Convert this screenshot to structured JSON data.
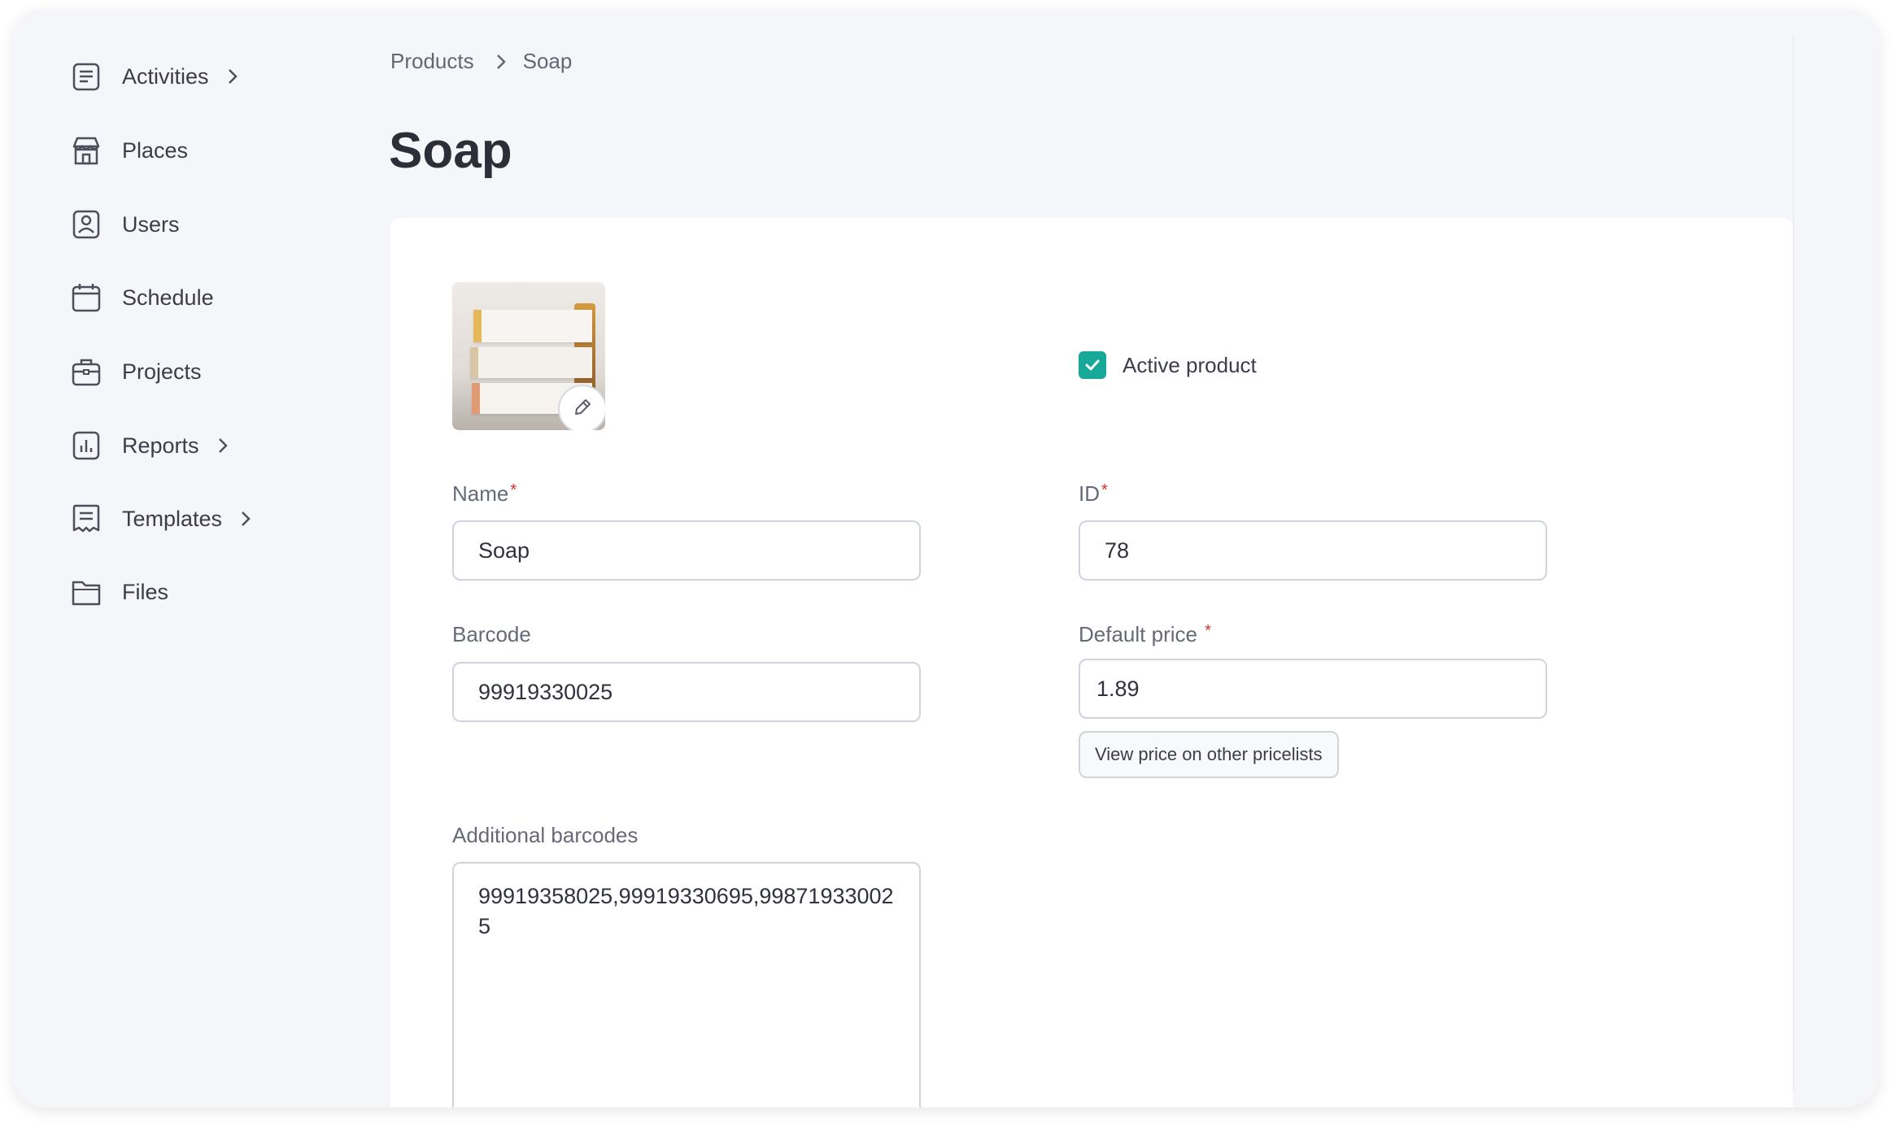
{
  "sidebar": {
    "items": [
      {
        "label": "Activities",
        "icon": "activities-icon",
        "has_submenu": true
      },
      {
        "label": "Places",
        "icon": "store-icon",
        "has_submenu": false
      },
      {
        "label": "Users",
        "icon": "user-icon",
        "has_submenu": false
      },
      {
        "label": "Schedule",
        "icon": "calendar-icon",
        "has_submenu": false
      },
      {
        "label": "Projects",
        "icon": "briefcase-icon",
        "has_submenu": false
      },
      {
        "label": "Reports",
        "icon": "chart-icon",
        "has_submenu": true
      },
      {
        "label": "Templates",
        "icon": "template-icon",
        "has_submenu": true
      },
      {
        "label": "Files",
        "icon": "folder-icon",
        "has_submenu": false
      }
    ]
  },
  "breadcrumb": {
    "parent": "Products",
    "current": "Soap"
  },
  "page": {
    "title": "Soap"
  },
  "product": {
    "active_label": "Active product",
    "active": true,
    "image_icon": "product-photo",
    "edit_icon": "pencil-icon"
  },
  "form": {
    "name_label": "Name",
    "name_value": "Soap",
    "id_label": "ID",
    "id_value": "78",
    "barcode_label": "Barcode",
    "barcode_value": "99919330025",
    "price_label": "Default price",
    "price_value": "1.89",
    "view_price_button": "View price on other pricelists",
    "additional_barcodes_label": "Additional barcodes",
    "additional_barcodes_value": "99919358025,99919330695,998719330025",
    "required_marker": "*"
  },
  "colors": {
    "accent": "#16a99a",
    "required": "#d32f2f",
    "background": "#f5f6fa"
  }
}
